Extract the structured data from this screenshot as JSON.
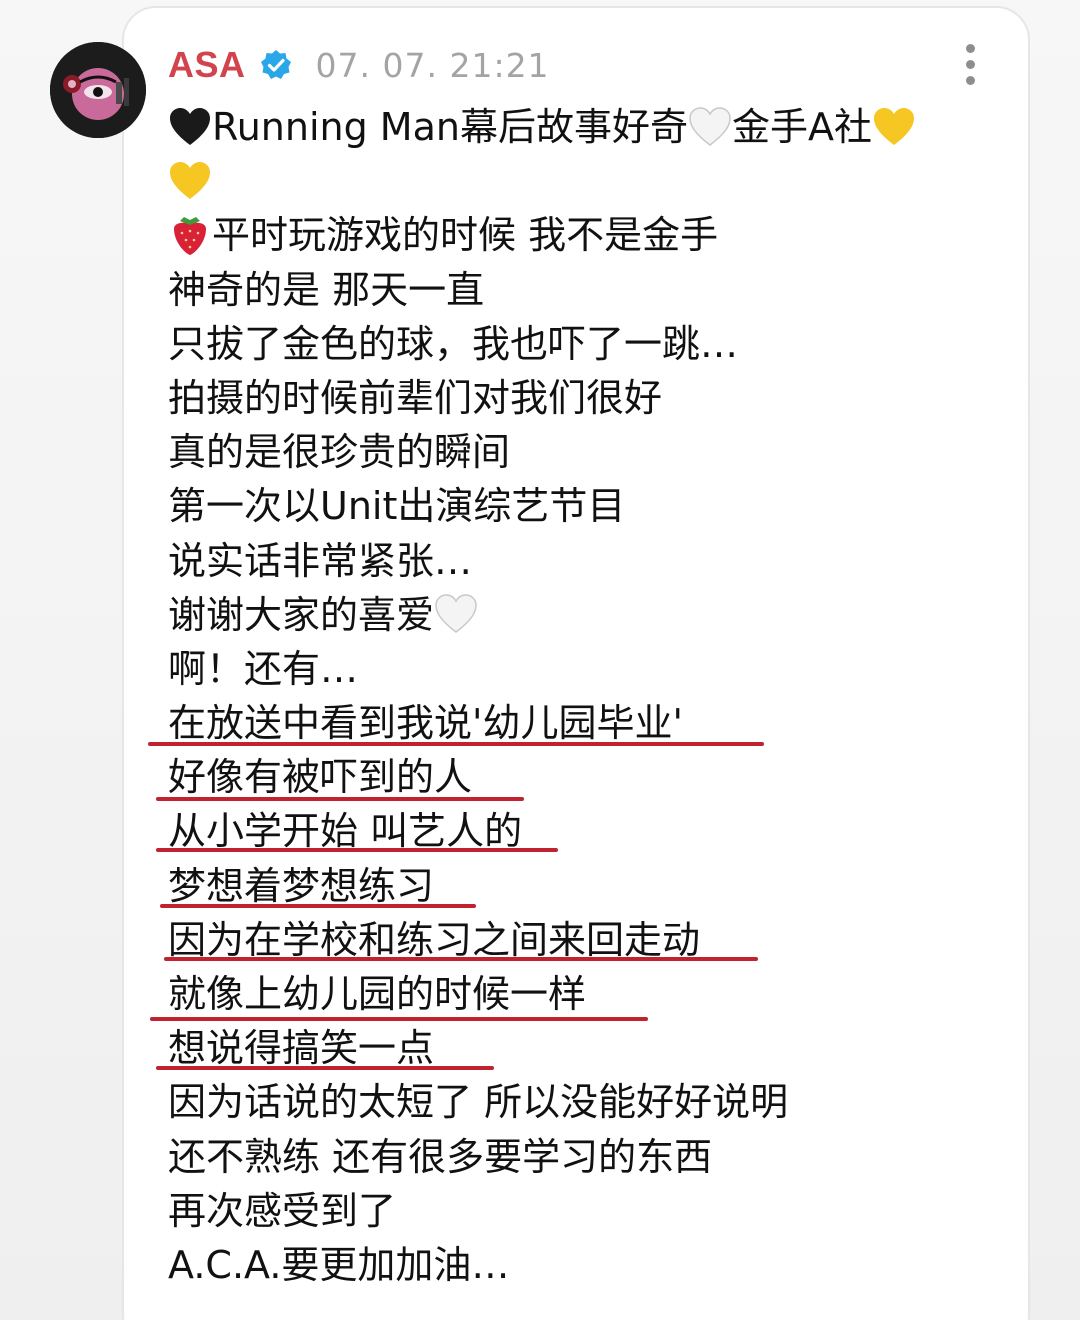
{
  "post": {
    "author": "ASA",
    "timestamp": "07. 07. 21:21",
    "line_1": "Running Man幕后故事好奇",
    "line_1b": "金手A社",
    "line_3": "平时玩游戏的时候 我不是金手",
    "line_4": "神奇的是 那天一直",
    "line_5": "只拔了金色的球，我也吓了一跳…",
    "line_6": "拍摄的时候前辈们对我们很好",
    "line_7": "真的是很珍贵的瞬间",
    "line_8": "第一次以Unit出演综艺节目",
    "line_9": "说实话非常紧张…",
    "line_10": "谢谢大家的喜爱",
    "line_11": "啊！还有…",
    "line_12": "在放送中看到我说'幼儿园毕业'",
    "line_13": "好像有被吓到的人",
    "line_14": "从小学开始 叫艺人的",
    "line_15": "梦想着梦想练习",
    "line_16": "因为在学校和练习之间来回走动",
    "line_17": "就像上幼儿园的时候一样",
    "line_18": "想说得搞笑一点",
    "line_19": "因为话说的太短了 所以没能好好说明",
    "line_20": "还不熟练 还有很多要学习的东西",
    "line_21": "再次感受到了",
    "line_22": "A.C.A.要更加加油…"
  },
  "icons": {
    "black_heart": "black-heart-icon",
    "white_heart": "white-heart-icon",
    "yellow_heart": "yellow-heart-icon",
    "strawberry": "strawberry-icon",
    "verified": "verified-badge-icon",
    "more": "more-options-icon"
  },
  "colors": {
    "username": "#d2434d",
    "timestamp": "#a4a4a4",
    "highlight_underline": "#c1222f",
    "verified_badge": "#2aa7e8"
  }
}
